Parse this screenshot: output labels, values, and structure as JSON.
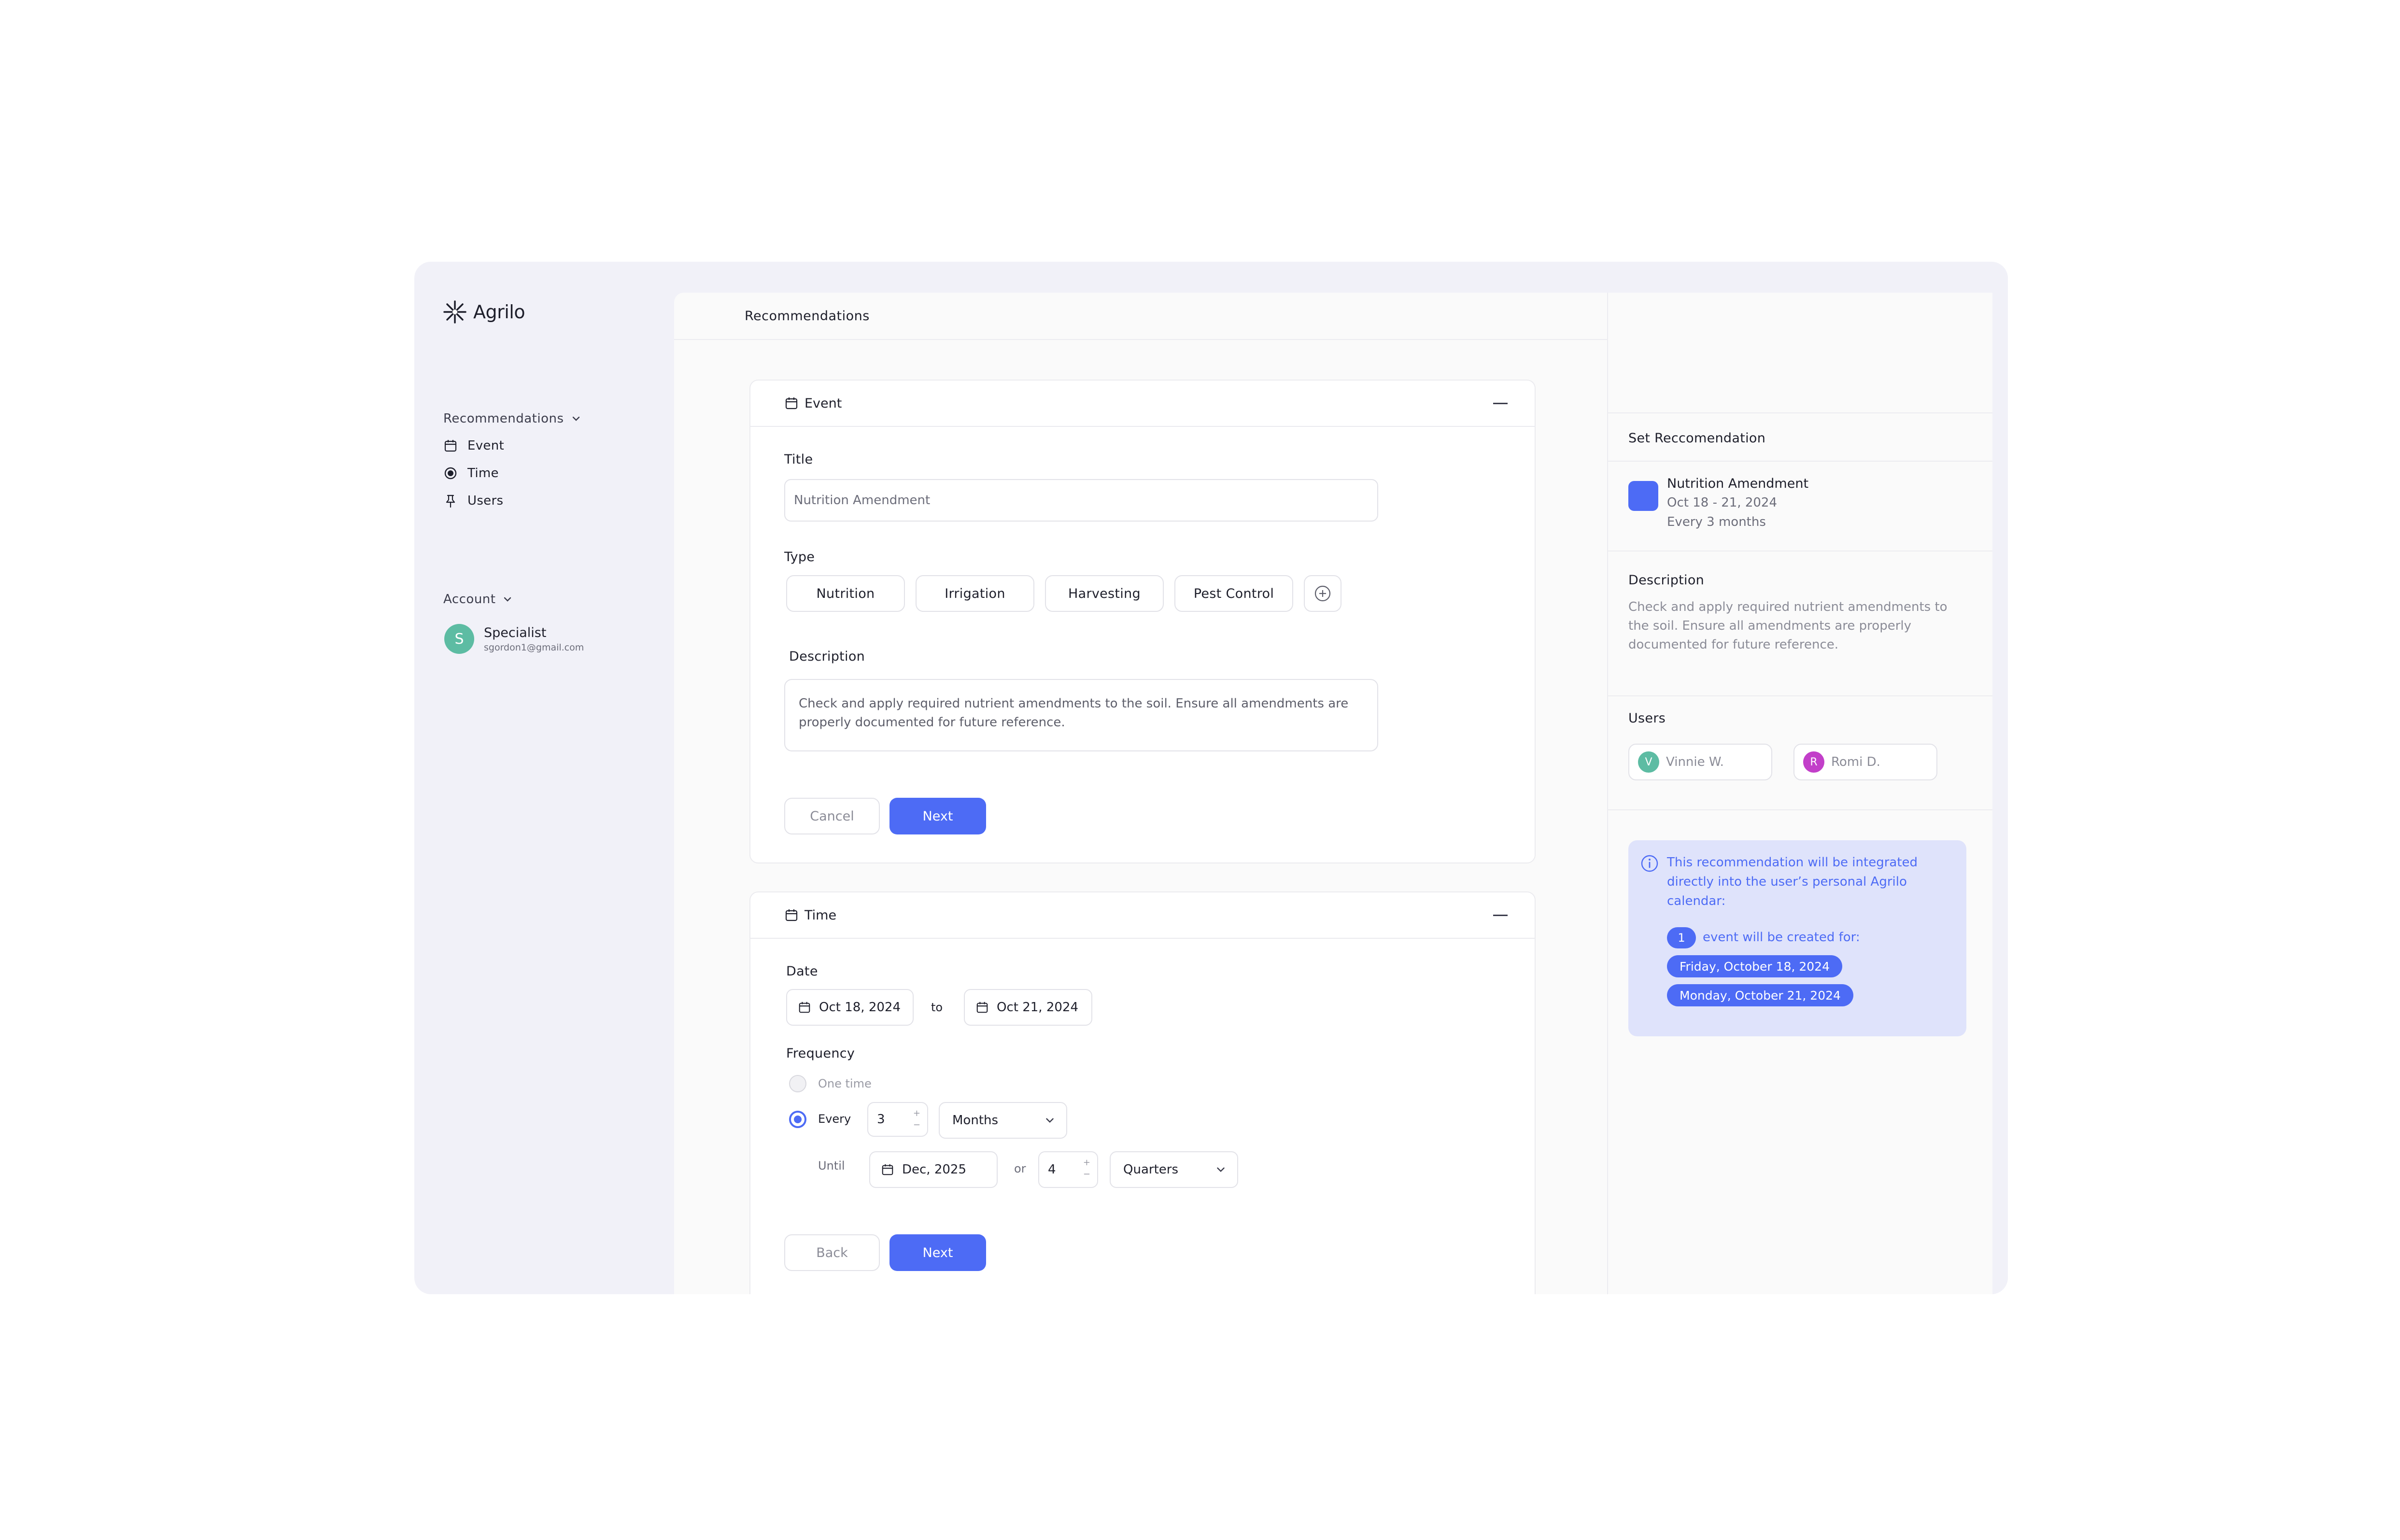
{
  "brand": {
    "name": "Agrilo"
  },
  "sidebar": {
    "section_label": "Recommendations",
    "items": [
      {
        "label": "Event",
        "icon": "calendar-icon"
      },
      {
        "label": "Time",
        "icon": "radio-icon"
      },
      {
        "label": "Users",
        "icon": "pin-icon"
      }
    ],
    "account_label": "Account",
    "account": {
      "initial": "S",
      "name": "Specialist",
      "email": "sgordon1@gmail.com"
    }
  },
  "main": {
    "header_title": "Recommendations",
    "event_card": {
      "title": "Event",
      "title_label": "Title",
      "title_value": "Nutrition Amendment",
      "type_label": "Type",
      "types": [
        "Nutrition",
        "Irrigation",
        "Harvesting",
        "Pest Control"
      ],
      "description_label": "Description",
      "description_value": "Check and apply required nutrient amendments to the soil. Ensure all amendments are properly documented for future reference.",
      "cancel_label": "Cancel",
      "next_label": "Next"
    },
    "time_card": {
      "title": "Time",
      "date_label": "Date",
      "date_from": "Oct 18, 2024",
      "to_label": "to",
      "date_to": "Oct 21, 2024",
      "frequency_label": "Frequency",
      "one_time_label": "One time",
      "every_label": "Every",
      "every_value": "3",
      "every_unit": "Months",
      "until_label": "Until",
      "until_value": "Dec, 2025",
      "or_label": "or",
      "or_value": "4",
      "or_unit": "Quarters",
      "back_label": "Back",
      "next_label": "Next"
    }
  },
  "right_panel": {
    "set_label": "Set Reccomendation",
    "summary_title": "Nutrition Amendment",
    "summary_dates": "Oct 18 - 21, 2024",
    "summary_freq": "Every 3 months",
    "description_label": "Description",
    "description": "Check and apply required nutrient amendments to the soil. Ensure all amendments are properly documented for future reference.",
    "users_label": "Users",
    "users": [
      {
        "initial": "V",
        "name": "Vinnie W.",
        "color": "#5dbca3"
      },
      {
        "initial": "R",
        "name": "Romi D.",
        "color": "#c23fc9"
      }
    ],
    "info": {
      "text": "This recommendation will be integrated directly into the user’s personal Agrilo calendar:",
      "count": "1",
      "count_text": "event will be created for:",
      "dates": [
        "Friday, October 18, 2024",
        "Monday, October 21, 2024"
      ]
    }
  },
  "colors": {
    "accent": "#4d6bf5",
    "background": "#f1f1f8",
    "info_bg": "#dfe3fb"
  }
}
